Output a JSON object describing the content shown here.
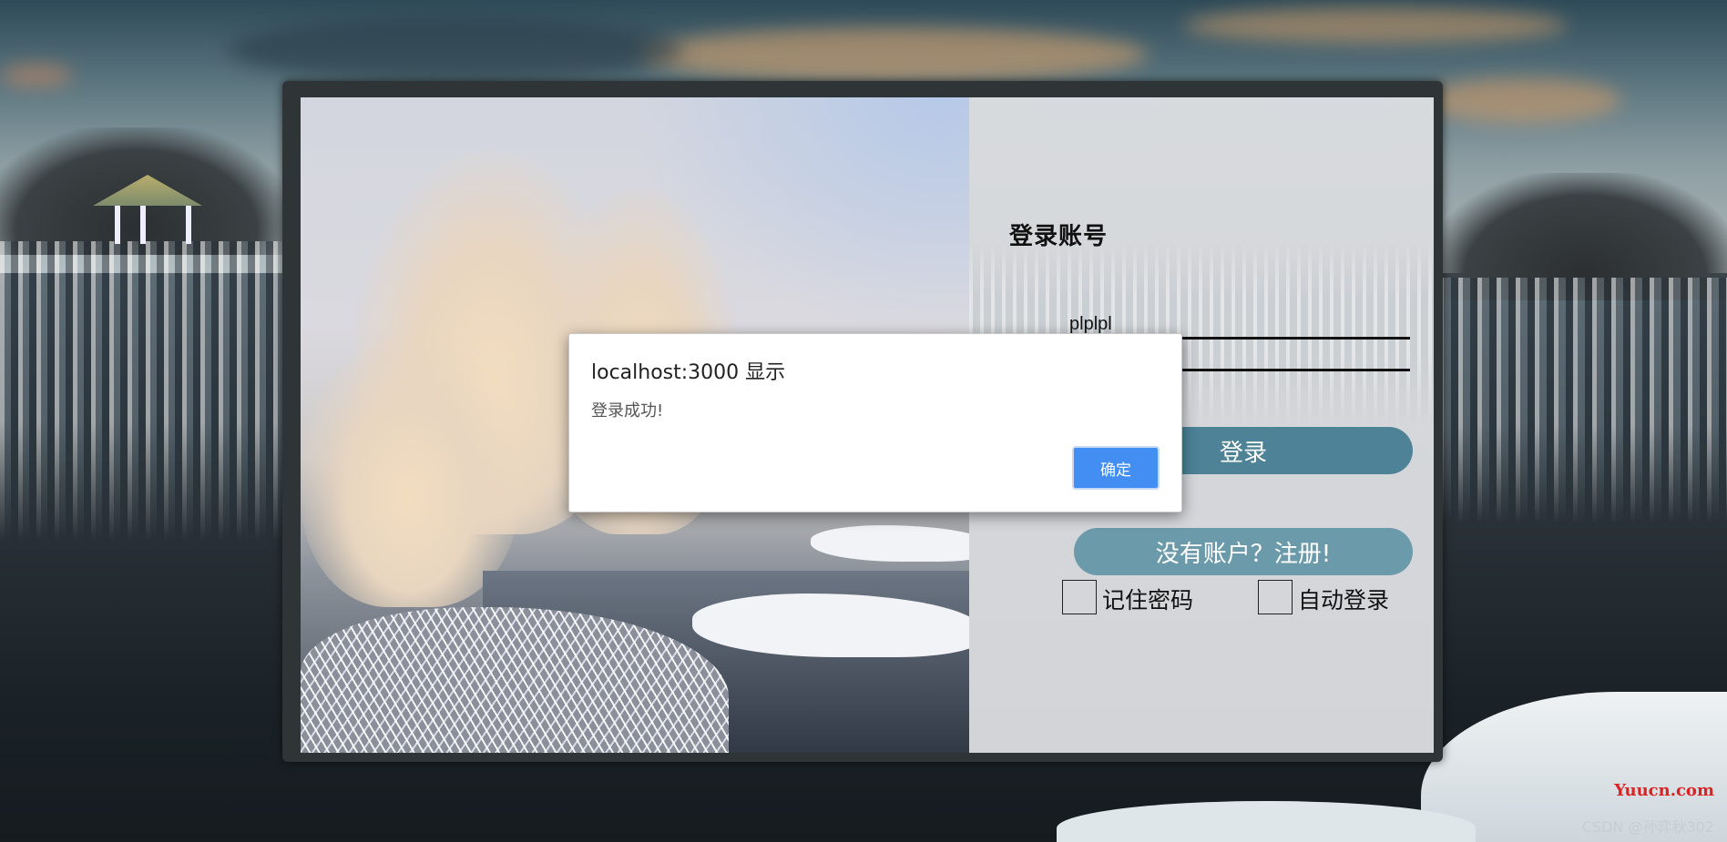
{
  "login_card": {
    "title": "登录账号",
    "username_value": "plplpl",
    "password_value": "",
    "login_button": "登录",
    "register_button": "没有账户？注册!",
    "remember_label": "记住密码",
    "auto_login_label": "自动登录",
    "remember_checked": false,
    "auto_login_checked": false,
    "button_colors": {
      "login": "#4d8297",
      "register": "#6b9aab"
    }
  },
  "alert": {
    "title": "localhost:3000 显示",
    "message": "登录成功!",
    "ok_label": "确定",
    "ok_color": "#428ef2"
  },
  "watermarks": {
    "site": "Yuucn.com",
    "author": "CSDN @孙弈秋302"
  }
}
